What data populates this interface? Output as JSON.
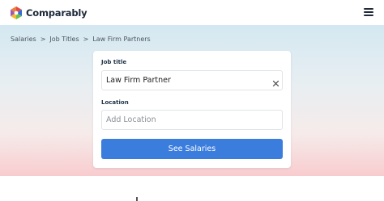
{
  "header": {
    "brand_name": "Comparably",
    "logo_icon": "comparably-logo-icon",
    "menu_icon": "hamburger-menu-icon"
  },
  "breadcrumb": {
    "items": [
      "Salaries",
      "Job Titles",
      "Law Firm Partners"
    ],
    "separator": ">"
  },
  "search_form": {
    "job_title_label": "Job title",
    "job_title_value": "Law Firm Partner",
    "clear_icon": "close-icon",
    "location_label": "Location",
    "location_placeholder": "Add Location",
    "location_value": "",
    "submit_label": "See Salaries"
  },
  "colors": {
    "accent": "#3b7ddd",
    "hero_top": "#d4e8f1",
    "hero_bottom": "#f8cccf",
    "logo_red": "#e8483f",
    "logo_blue": "#2e6fd8",
    "logo_green": "#6cc04a",
    "logo_yellow": "#f5b82e"
  }
}
